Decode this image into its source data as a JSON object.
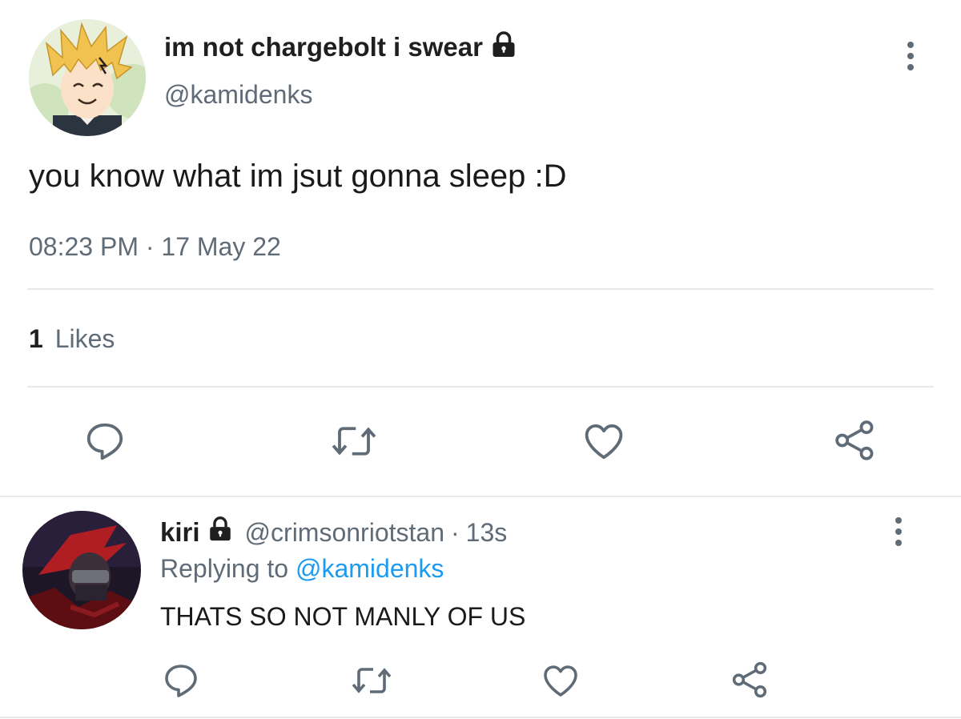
{
  "tweet": {
    "display_name": "im not chargebolt i swear",
    "handle": "@kamidenks",
    "text": "you know what im jsut gonna sleep :D",
    "time": "08:23 PM",
    "separator": "·",
    "date": "17 May 22",
    "likes_count": "1",
    "likes_label": "Likes",
    "locked": true,
    "avatar": "anime-boy-blonde-hair"
  },
  "reply": {
    "display_name": "kiri",
    "handle": "@crimsonriotstan",
    "separator": "·",
    "age": "13s",
    "replying_to_label": "Replying to",
    "replying_to_handle": "@kamidenks",
    "text": "THATS SO NOT MANLY OF US",
    "locked": true,
    "avatar": "anime-boy-red-hair-masked"
  },
  "actions": [
    "reply-icon",
    "retweet-icon",
    "like-icon",
    "share-icon"
  ],
  "colors": {
    "text": "#1a1a1a",
    "secondary": "#5f6b77",
    "link": "#1d9bf0",
    "divider": "#e6e8eb"
  }
}
